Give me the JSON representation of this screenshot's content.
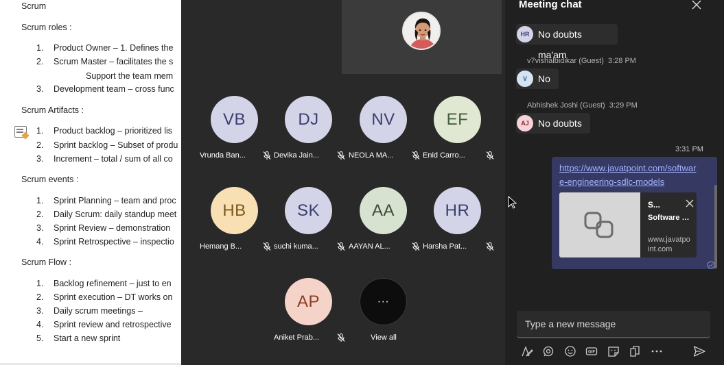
{
  "document": {
    "lines": [
      "Scrum",
      "Scrum roles :",
      "1.",
      "Product Owner –  1. Defines the",
      "2.",
      "Scrum Master – facilitates the s",
      "Support the team mem",
      "3.",
      "Development team – cross func",
      "Scrum Artifacts :",
      "1.",
      "Product backlog – prioritized lis",
      "2.",
      "Sprint backlog – Subset of produ",
      "3.",
      "Increment – total / sum of all co",
      "Scrum events :",
      "1.",
      "Sprint Planning – team and proc",
      "2.",
      "Daily Scrum: daily standup meet",
      "3.",
      "Sprint Review – demonstration",
      "4.",
      "Sprint Retrospective – inspectio",
      "Scrum Flow :",
      "1.",
      "Backlog refinement – just to en",
      "2.",
      "Sprint execution –  DT works on",
      "3.",
      "Daily scrum meetings –",
      "4.",
      "Sprint review and retrospective",
      "5.",
      "Start a new sprint"
    ]
  },
  "participants": [
    {
      "initials": "VB",
      "name": "Vrunda Ban...",
      "bg": "#d4d4e8",
      "fg": "#3a3f6e"
    },
    {
      "initials": "DJ",
      "name": "Devika Jain...",
      "bg": "#d4d4e8",
      "fg": "#3a3f6e"
    },
    {
      "initials": "NV",
      "name": "NEOLA MA...",
      "bg": "#d4d4e8",
      "fg": "#3a3f6e"
    },
    {
      "initials": "EF",
      "name": "Enid Carro...",
      "bg": "#e0e8d4",
      "fg": "#45603a"
    },
    {
      "initials": "HB",
      "name": "Hemang B...",
      "bg": "#f9dfb4",
      "fg": "#7a5a1e"
    },
    {
      "initials": "SK",
      "name": "suchi kuma...",
      "bg": "#d4d4e8",
      "fg": "#3a3f6e"
    },
    {
      "initials": "AA",
      "name": "AAYAN AL...",
      "bg": "#d8e2d0",
      "fg": "#3a4f32"
    },
    {
      "initials": "HR",
      "name": "Harsha Pat...",
      "bg": "#d4d4e8",
      "fg": "#3a3f6e"
    },
    {
      "initials": "AP",
      "name": "Aniket Prab...",
      "bg": "#f6d3c8",
      "fg": "#8a3e24"
    },
    {
      "initials": "···",
      "name": "View all",
      "bg": "#0d0d0d",
      "fg": "#ffffff"
    }
  ],
  "chat": {
    "title": "Meeting chat",
    "messages": [
      {
        "avatar": "HR",
        "avatar_bg": "#d4d4e8",
        "avatar_fg": "#3a3f6e",
        "text": "No doubts ma'am"
      },
      {
        "sender": "v7vishalbidikar (Guest)",
        "time": "3:28 PM",
        "avatar": "V",
        "avatar_bg": "#d4e4f2",
        "avatar_fg": "#2d5a86",
        "text": "No"
      },
      {
        "sender": "Abhishek Joshi (Guest)",
        "time": "3:29 PM",
        "avatar": "AJ",
        "avatar_bg": "#f6d3d8",
        "avatar_fg": "#8a2435",
        "text": "No doubts"
      }
    ],
    "own_message": {
      "time": "3:31 PM",
      "link": "https://www.javatpoint.com/software-engineering-sdlc-models",
      "preview_title": "S...",
      "preview_desc": "Software Engineeri...",
      "preview_domain": "www.javatpoint.com"
    },
    "compose_placeholder": "Type a new message"
  },
  "colors": {
    "stage_bg": "#292929",
    "chat_bg": "#202020",
    "own_bubble": "#363a63",
    "link": "#a3b3ff"
  }
}
